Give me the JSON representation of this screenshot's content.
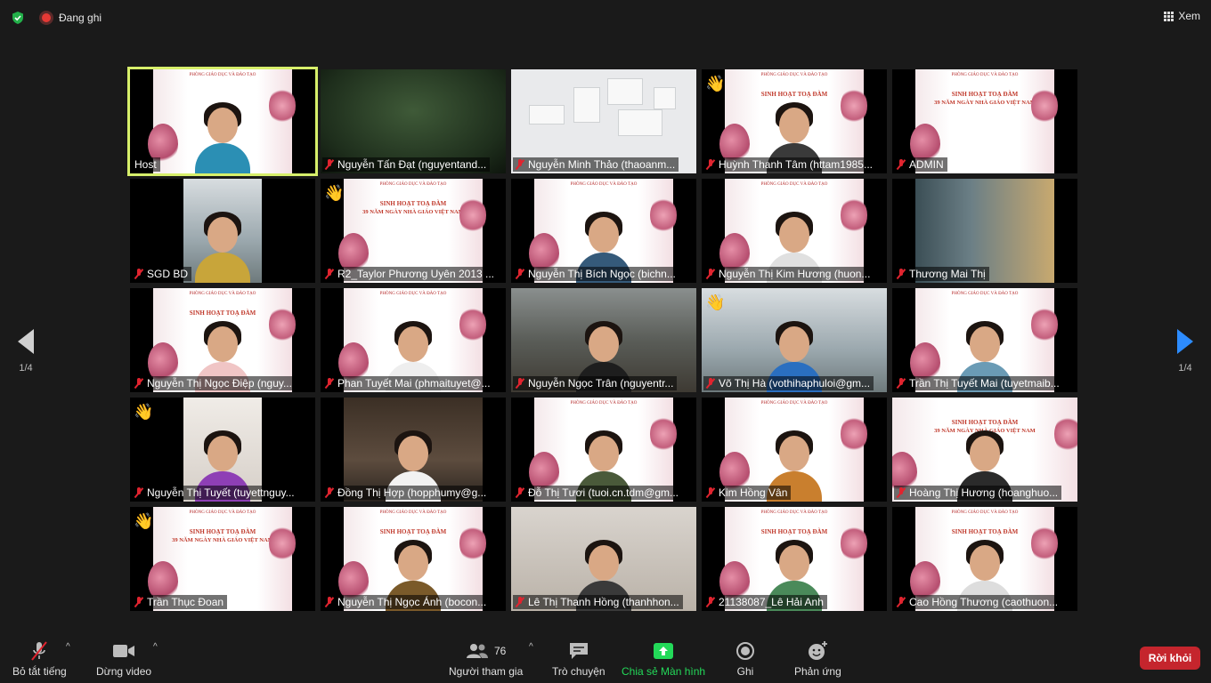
{
  "top_bar": {
    "recording_label": "Đang ghi",
    "view_label": "Xem"
  },
  "pagination": {
    "left": "1/4",
    "right": "1/4"
  },
  "participants": [
    {
      "name": "Host",
      "muted": false
    },
    {
      "name": "Nguyễn Tấn Đạt (nguyentand...",
      "muted": true
    },
    {
      "name": "Nguyễn Minh Thảo (thaoanm...",
      "muted": true
    },
    {
      "name": "Huỳnh Thanh Tâm (httam1985...",
      "muted": true
    },
    {
      "name": "ADMIN",
      "muted": true
    },
    {
      "name": "SGD BD",
      "muted": true
    },
    {
      "name": "R2_Taylor Phương Uyên 2013 ...",
      "muted": true
    },
    {
      "name": "Nguyễn Thị Bích Ngọc (bichn...",
      "muted": true
    },
    {
      "name": "Nguyễn Thị Kim Hương (huon...",
      "muted": true
    },
    {
      "name": "Thương Mai Thị",
      "muted": true
    },
    {
      "name": "Nguyễn Thị Ngọc Điệp (nguy...",
      "muted": true
    },
    {
      "name": "Phan Tuyết Mai (phmaituyet@...",
      "muted": true
    },
    {
      "name": "Nguyễn Ngọc Trân (nguyentr...",
      "muted": true
    },
    {
      "name": "Võ Thị Hà (vothihaphuloi@gm...",
      "muted": true
    },
    {
      "name": "Trần Thị Tuyết Mai (tuyetmaib...",
      "muted": true
    },
    {
      "name": "Nguyễn Thị Tuyết (tuyettnguy...",
      "muted": true
    },
    {
      "name": "Đồng Thị Hợp (hopphumy@g...",
      "muted": true
    },
    {
      "name": "Đỗ Thị Tươi (tuoi.cn.tdm@gm...",
      "muted": true
    },
    {
      "name": "Kim Hồng Vân",
      "muted": true
    },
    {
      "name": "Hoàng Thị Hương (hoanghuo...",
      "muted": true
    },
    {
      "name": "Trần Thục Đoan",
      "muted": true
    },
    {
      "name": "Nguyễn Thị Ngọc Ánh (bocon...",
      "muted": true
    },
    {
      "name": "Lê Thị Thanh Hồng (thanhhon...",
      "muted": true
    },
    {
      "name": "21138087_Lê Hải Anh",
      "muted": true
    },
    {
      "name": "Cao Hồng Thương (caothuon...",
      "muted": true
    }
  ],
  "banner": {
    "line1": "PHÒNG GIÁO DỤC VÀ ĐÀO TẠO",
    "line2": "SINH HOẠT TOẠ ĐÀM",
    "line3": "39 NĂM NGÀY NHÀ GIÁO VIỆT NAM"
  },
  "toolbar": {
    "mute_label": "Bỏ tắt tiếng",
    "video_label": "Dừng video",
    "participants_label": "Người tham gia",
    "participants_count": "76",
    "chat_label": "Trò chuyện",
    "share_label": "Chia sẻ Màn hình",
    "record_label": "Ghi",
    "reactions_label": "Phản ứng",
    "leave_label": "Rời khỏi"
  },
  "colors": {
    "share_green": "#23d959",
    "leave_red": "#c5252d",
    "active_speaker": "#d7ef6b",
    "nav_blue": "#2d8cff"
  }
}
